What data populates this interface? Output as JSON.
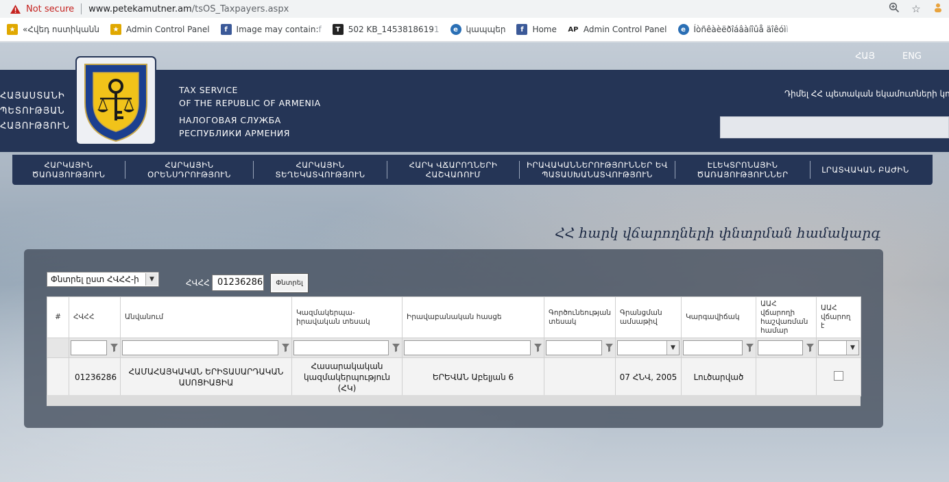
{
  "browser": {
    "security_label": "Not secure",
    "url_domain": "www.petekamutner.am",
    "url_path": "/tsOS_Taxpayers.aspx",
    "bookmarks": [
      {
        "label": "«Հվեդ ոստիկանն",
        "icon": "gold-star-icon"
      },
      {
        "label": "Admin Control Panel",
        "icon": "gold-star-icon"
      },
      {
        "label": "Image may contain: ",
        "fade": "f",
        "icon": "facebook-icon"
      },
      {
        "label": "502 KB_1453818619",
        "fade": "1",
        "icon": "t-icon"
      },
      {
        "label": "կապպեր",
        "icon": "e-icon"
      },
      {
        "label": "Home",
        "icon": "facebook-icon"
      },
      {
        "label": "Admin Control Panel",
        "icon": "ap-icon"
      },
      {
        "label": "Íòñêàèëðîáâàíîûå äîêóì",
        "fade": "ì",
        "icon": "e-icon"
      }
    ]
  },
  "page": {
    "languages": [
      "ՀԱՅ",
      "ENG"
    ],
    "left_words": [
      "ՀԱՅԱՍՏԱՆԻ",
      "ՊԵՏՈՒԹՅԱՆ",
      "ՀԱՅՈՒԹՅՈՒՆ"
    ],
    "org_en_1": "TAX SERVICE",
    "org_en_2": "OF THE REPUBLIC OF ARMENIA",
    "org_ru_1": "НАЛОГОВАЯ СЛУЖБА",
    "org_ru_2": "РЕСПУБЛИКИ АРМЕНИЯ",
    "contact_text": "Դիմել ՀՀ պետական եկամուտների կոմիտ",
    "nav": [
      {
        "line1": "ՀԱՐԿԱՅԻՆ",
        "line2": "ԾԱՌԱՅՈՒԹՅՈՒՆ"
      },
      {
        "line1": "ՀԱՐԿԱՅԻՆ",
        "line2": "ՕՐԵՆՍԴՐՈՒԹՅՈՒՆ"
      },
      {
        "line1": "ՀԱՐԿԱՅԻՆ",
        "line2": "ՏԵՂԵԿԱՏՎՈՒԹՅՈՒՆ"
      },
      {
        "line1": "ՀԱՐԿ ՎՃԱՐՈՂՆԵՐԻ",
        "line2": "ՀԱՇՎԱՌՈՒՄ"
      },
      {
        "line1": "ԻՐԱՎԱԿԱՆՆԵՐՈՒԹՅՈՒՆՆԵՐ ԵՎ",
        "line2": "ՊԱՏԱՍԽԱՆԱՏՎՈՒԹՅՈՒՆ"
      },
      {
        "line1": "ԷԼԵԿՏՐՈՆԱՅԻՆ",
        "line2": "ԾԱՌԱՅՈՒԹՅՈՒՆՆԵՐ"
      },
      {
        "line1": "ԼՐԱՏՎԱԿԱՆ ԲԱԺԻՆ",
        "line2": ""
      }
    ],
    "system_title": "ՀՀ հարկ վճարողների փնտրման համակարգ"
  },
  "search": {
    "mode_selected": "Փնտրել ըստ ՀՎՀՀ-ի",
    "tin_label": "ՀՎՀՀ",
    "tin_value": "01236286",
    "button_label": "Փնտրել"
  },
  "grid": {
    "columns": [
      "#",
      "ՀՎՀՀ",
      "Անվանում",
      "Կազմակերպա-իրավական տեսակ",
      "Իրավաբանական հասցե",
      "Գործունեության տեսակ",
      "Գրանցման ամսաթիվ",
      "Կարգավիճակ",
      "ԱԱՀ վճարողի հաշվառման համար",
      "ԱԱՀ վճարող է"
    ],
    "rows": [
      {
        "tin": "01236286",
        "name": "ՀԱՄԱՀԱՅԿԱԿԱՆ ԵՐԻՏԱՍԱՐԴԱԿԱՆ ԱՍՈՑԻԱՑԻԱ",
        "legal_form": "Հասարակական կազմակերպություն (ՀԿ)",
        "address": "ԵՐԵՎԱՆ Աբելյան 6",
        "activity": "",
        "reg_date": "07 ՀՆՎ, 2005",
        "status": "Լուծարված",
        "vat_number": ""
      }
    ]
  }
}
